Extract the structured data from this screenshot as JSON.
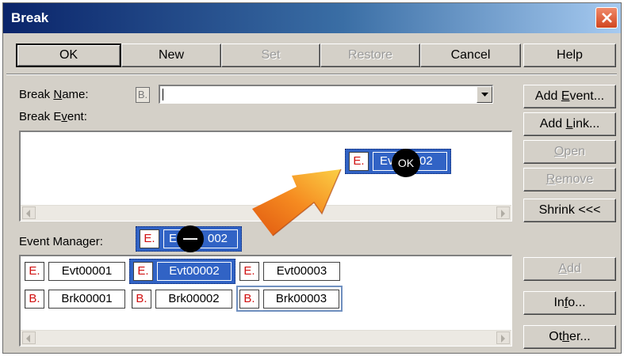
{
  "window": {
    "title": "Break"
  },
  "toolbar": {
    "ok": "OK",
    "new": "New",
    "set": "Set",
    "restore": "Restore",
    "cancel": "Cancel",
    "help": "Help"
  },
  "form": {
    "break_name_prefix": "Break ",
    "break_name_key": "N",
    "break_name_suffix": "ame:",
    "break_event_prefix": "Break E",
    "break_event_key": "v",
    "break_event_suffix": "ent:",
    "break_name_value": "",
    "event_manager_label": "Event Manager:",
    "b_icon": "B."
  },
  "side_buttons": {
    "add_event": {
      "pre": "Add ",
      "key": "E",
      "post": "vent..."
    },
    "add_link": {
      "pre": "Add ",
      "key": "L",
      "post": "ink..."
    },
    "open": {
      "pre": "",
      "key": "O",
      "post": "pen"
    },
    "remove": {
      "pre": "",
      "key": "R",
      "post": "emove"
    },
    "shrink": "Shrink <<<",
    "add": {
      "pre": "",
      "key": "A",
      "post": "dd"
    },
    "info": {
      "pre": "In",
      "key": "f",
      "post": "o..."
    },
    "other": {
      "pre": "Ot",
      "key": "h",
      "post": "er..."
    }
  },
  "drag": {
    "event_chip_tag": "E.",
    "event_chip_prefix": "Ev",
    "event_chip_cursor": "OK",
    "event_chip_suffix": "02",
    "manager_chip_tag": "E.",
    "manager_chip_prefix": "E",
    "manager_chip_suffix": "002",
    "manager_cursor": "—"
  },
  "event_manager": {
    "events": [
      {
        "tag": "E.",
        "name": "Evt00001",
        "selected": false
      },
      {
        "tag": "E.",
        "name": "Evt00002",
        "selected": true
      },
      {
        "tag": "E.",
        "name": "Evt00003",
        "selected": false
      }
    ],
    "breaks": [
      {
        "tag": "B.",
        "name": "Brk00001",
        "selected": false
      },
      {
        "tag": "B.",
        "name": "Brk00002",
        "selected": false
      },
      {
        "tag": "B.",
        "name": "Brk00003",
        "selected": false
      }
    ]
  },
  "colors": {
    "title_bar": "#0a246a",
    "selection": "#3163c5",
    "tag_red": "#d01010",
    "arrow_orange": "#f08020"
  }
}
